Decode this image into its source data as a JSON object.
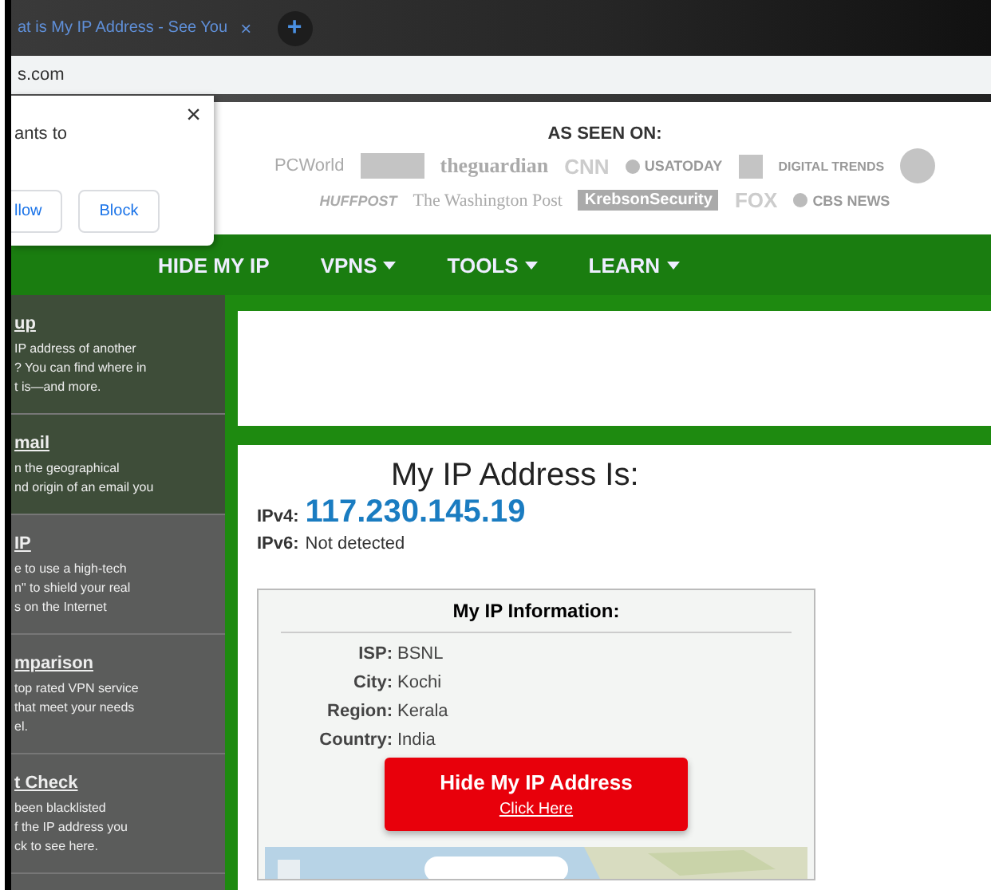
{
  "browser": {
    "tab_title": "at is My IP Address - See You",
    "tab_close": "×",
    "new_tab": "+",
    "url": "s.com"
  },
  "popup": {
    "text": "ants to",
    "close": "×",
    "buttons": [
      "llow",
      "Block"
    ]
  },
  "press": {
    "heading": "AS SEEN ON:",
    "rows": [
      {
        "logos": [
          {
            "kind": "sans",
            "text": "PCWorld"
          },
          {
            "kind": "badge-square"
          },
          {
            "kind": "serif-bold",
            "text": "theguardian"
          },
          {
            "kind": "outline",
            "text": "CNN"
          },
          {
            "kind": "dot",
            "text": "USATODAY"
          },
          {
            "kind": "badge-plus"
          },
          {
            "kind": "caps",
            "text": "DIGITAL TRENDS"
          },
          {
            "kind": "badge-circle"
          }
        ]
      },
      {
        "logos": [
          {
            "kind": "italic",
            "text": "HUFFPOST"
          },
          {
            "kind": "serif",
            "text": "The Washington Post"
          },
          {
            "kind": "boxed",
            "text": "KrebsonSecurity"
          },
          {
            "kind": "outline",
            "text": "FOX"
          },
          {
            "kind": "dot",
            "text": "CBS NEWS"
          }
        ]
      }
    ]
  },
  "nav": [
    {
      "label": "HIDE MY IP",
      "dropdown": false
    },
    {
      "label": "VPNS",
      "dropdown": true
    },
    {
      "label": "TOOLS",
      "dropdown": true
    },
    {
      "label": "LEARN",
      "dropdown": true
    }
  ],
  "sidebar": [
    {
      "kind": "featured",
      "title": "up",
      "text": "IP address of another\n? You can find where in\nt is—and more."
    },
    {
      "kind": "featured",
      "title": "mail",
      "text": "n the geographical\nnd origin of an email you"
    },
    {
      "kind": "regular",
      "title": "IP",
      "text": "e to use a high-tech\nn\" to shield your real\ns on the Internet"
    },
    {
      "kind": "regular",
      "title": "mparison",
      "text": "top rated VPN service\nthat meet your needs\nel."
    },
    {
      "kind": "regular",
      "title": "t Check",
      "text": "been blacklisted\nf the IP address you\nck to see here."
    }
  ],
  "ip": {
    "heading": "My IP Address Is:",
    "ipv4_label": "IPv4:",
    "ipv4": "117.230.145.19",
    "ipv6_label": "IPv6:",
    "ipv6": "Not detected"
  },
  "info": {
    "title": "My IP Information:",
    "rows": [
      {
        "label": "ISP:",
        "value": "BSNL"
      },
      {
        "label": "City:",
        "value": "Kochi"
      },
      {
        "label": "Region:",
        "value": "Kerala"
      },
      {
        "label": "Country:",
        "value": "India"
      }
    ],
    "button": {
      "title": "Hide My IP Address",
      "link": "Click Here"
    }
  }
}
